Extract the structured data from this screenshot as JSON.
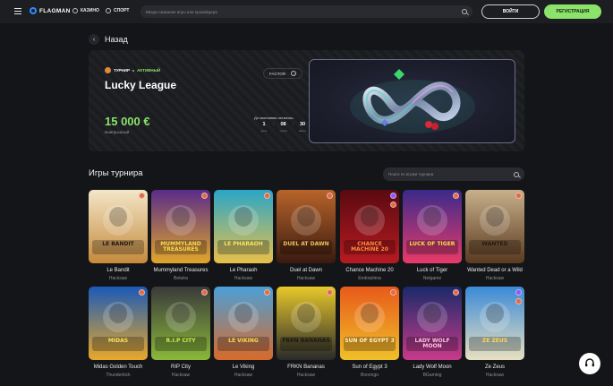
{
  "header": {
    "logo": "FLAGMAN",
    "nav": [
      {
        "label": "КАЗИНО"
      },
      {
        "label": "СПОРТ"
      }
    ],
    "search_placeholder": "Введи название игры или провайдера",
    "login_label": "ВОЙТИ",
    "register_label": "РЕГИСТРАЦИЯ"
  },
  "back_label": "Назад",
  "tournament": {
    "type_label": "ТУРНИР",
    "status_label": "АКТИВНЫЙ",
    "name": "Lucky League",
    "factor_label": "FACTOR",
    "prize": "15 000 €",
    "prize_caption": "выигрышный",
    "ends_label": "До окончания осталось:",
    "timer": [
      {
        "value": "1",
        "unit": "день"
      },
      {
        "value": "08",
        "unit": "часов"
      },
      {
        "value": "30",
        "unit": "минут"
      }
    ]
  },
  "games_section": {
    "title": "Игры турнира",
    "search_placeholder": "Поиск по играм турнира"
  },
  "games": [
    {
      "title": "Le Bandit",
      "provider": "Hacksaw",
      "badge": "orange"
    },
    {
      "title": "Mummyland Treasures",
      "provider": "Belatra",
      "badge": "orange"
    },
    {
      "title": "Le Pharaoh",
      "provider": "Hacksaw",
      "badge": "orange"
    },
    {
      "title": "Duel at Dawn",
      "provider": "Hacksaw",
      "badge": "orange"
    },
    {
      "title": "Chance Machine 20",
      "provider": "Endorphina",
      "badge": "purple"
    },
    {
      "title": "Luck of Tiger",
      "provider": "Netgame",
      "badge": "orange"
    },
    {
      "title": "Wanted Dead or a Wild",
      "provider": "Hacksaw",
      "badge": "orange"
    },
    {
      "title": "Midas Golden Touch",
      "provider": "Thunderkick",
      "badge": "orange"
    },
    {
      "title": "RIP City",
      "provider": "Hacksaw",
      "badge": "orange"
    },
    {
      "title": "Le Viking",
      "provider": "Hacksaw",
      "badge": "orange"
    },
    {
      "title": "FRKN Bananas",
      "provider": "Hacksaw",
      "badge": "orange"
    },
    {
      "title": "Sun of Egypt 3",
      "provider": "Booongo",
      "badge": "orange"
    },
    {
      "title": "Lady Wolf Moon",
      "provider": "BGaming",
      "badge": "orange"
    },
    {
      "title": "Ze Zeus",
      "provider": "Hacksaw",
      "badge": "purple"
    }
  ],
  "thumb_art": [
    {
      "c1": "#f3e6c8",
      "c2": "#c58a3c",
      "text": "LE BANDIT",
      "tc": "#2a1a0e"
    },
    {
      "c1": "#5a2b8a",
      "c2": "#e0a52a",
      "text": "MUMMYLAND TREASURES",
      "tc": "#ffd84a"
    },
    {
      "c1": "#2aa6c8",
      "c2": "#e8c04a",
      "text": "LE PHARAOH",
      "tc": "#ffe25a"
    },
    {
      "c1": "#b8642a",
      "c2": "#3a1a10",
      "text": "DUEL AT DAWN",
      "tc": "#f0c05a"
    },
    {
      "c1": "#5a0a10",
      "c2": "#b81a22",
      "text": "CHANCE MACHINE 20",
      "tc": "#ff8a3a"
    },
    {
      "c1": "#3a2a8a",
      "c2": "#e83a6a",
      "text": "LUCK OF TIGER",
      "tc": "#ffd84a"
    },
    {
      "c1": "#c8b08a",
      "c2": "#5a3a20",
      "text": "WANTED",
      "tc": "#2a1a0e"
    },
    {
      "c1": "#1a5ab8",
      "c2": "#e8a82a",
      "text": "MIDAS",
      "tc": "#ffe25a"
    },
    {
      "c1": "#3a3a3a",
      "c2": "#8ab83a",
      "text": "R.I.P CITY",
      "tc": "#c8f04a"
    },
    {
      "c1": "#4aa0d8",
      "c2": "#d86a2a",
      "text": "LE VIKING",
      "tc": "#ffd84a"
    },
    {
      "c1": "#e8c82a",
      "c2": "#2a2a2a",
      "text": "FRKN BANANAS",
      "tc": "#1a1a1a"
    },
    {
      "c1": "#e85a1a",
      "c2": "#f0c02a",
      "text": "SUN OF EGYPT 3",
      "tc": "#fff4c0"
    },
    {
      "c1": "#1a2a6a",
      "c2": "#c83a8a",
      "text": "LADY WOLF MOON",
      "tc": "#ffc0e0"
    },
    {
      "c1": "#3a8ad8",
      "c2": "#e8e0c0",
      "text": "ZE ZEUS",
      "tc": "#ffd84a"
    }
  ],
  "colors": {
    "accent": "#8be36b",
    "background": "#141518",
    "badge_orange": "#e06a4a",
    "badge_purple": "#8a5cf0"
  },
  "icons": [
    "menu-icon",
    "casino-icon",
    "sport-icon",
    "search-icon",
    "back-icon",
    "info-icon",
    "support-icon"
  ]
}
